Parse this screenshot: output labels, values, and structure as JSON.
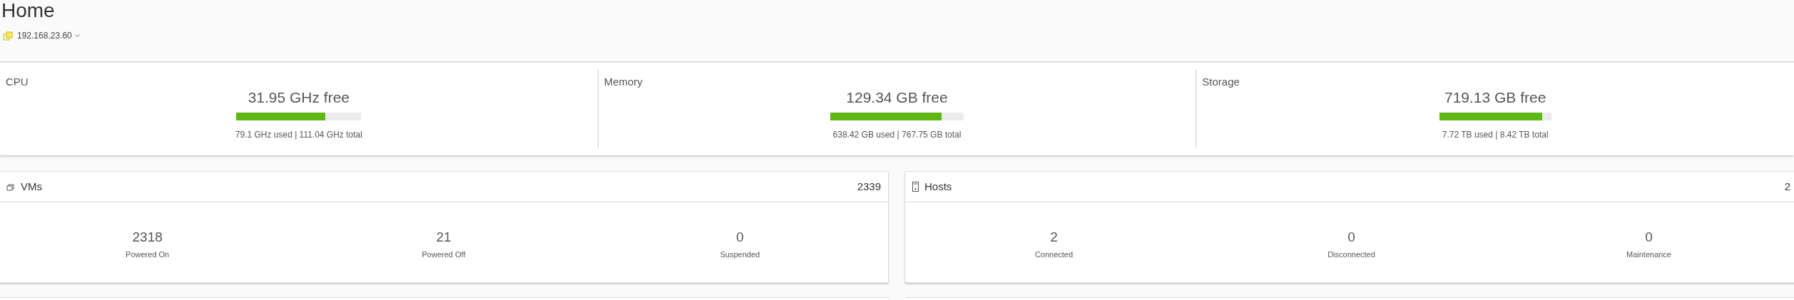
{
  "page": {
    "title": "Home",
    "host": "192.168.23.60"
  },
  "resources": [
    {
      "name": "CPU",
      "free": "31.95 GHz free",
      "level": 0.712,
      "detail": "79.1 GHz used | 111.04 GHz total"
    },
    {
      "name": "Memory",
      "free": "129.34 GB free",
      "level": 0.832,
      "detail": "638.42 GB used | 767.75 GB total"
    },
    {
      "name": "Storage",
      "free": "719.13 GB free",
      "level": 0.917,
      "detail": "7.72 TB used | 8.42 TB total"
    }
  ],
  "cards": [
    {
      "kind": "vms",
      "title": "VMs",
      "total": "2339",
      "stats": [
        {
          "value": "2318",
          "label": "Powered On"
        },
        {
          "value": "21",
          "label": "Powered Off"
        },
        {
          "value": "0",
          "label": "Suspended"
        }
      ]
    },
    {
      "kind": "hosts",
      "title": "Hosts",
      "total": "2",
      "stats": [
        {
          "value": "2",
          "label": "Connected"
        },
        {
          "value": "0",
          "label": "Disconnected"
        },
        {
          "value": "0",
          "label": "Maintenance"
        }
      ]
    }
  ]
}
